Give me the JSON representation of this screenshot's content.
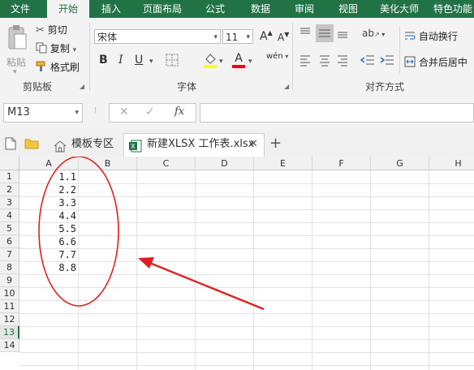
{
  "ribbon_tabs": [
    "文件",
    "开始",
    "插入",
    "页面布局",
    "公式",
    "数据",
    "审阅",
    "视图",
    "美化大师",
    "特色功能"
  ],
  "clipboard": {
    "paste": "粘贴",
    "cut": "剪切",
    "copy": "复制",
    "painter": "格式刷",
    "group": "剪贴板"
  },
  "font": {
    "name": "宋体",
    "size": "11",
    "group": "字体",
    "bold": "B",
    "italic": "I",
    "underline": "U",
    "grow": "A",
    "shrink": "A",
    "fill_color": "#ffff00",
    "font_color": "#ff0000",
    "phonetic": "wén"
  },
  "alignment": {
    "wrap": "自动换行",
    "merge": "合并后居中",
    "group": "对齐方式"
  },
  "formula_bar": {
    "name_box": "M13",
    "fx": "fx",
    "value": ""
  },
  "doc_tabs": {
    "template": "模板专区",
    "file": "新建XLSX 工作表.xlsx",
    "add": "+"
  },
  "sheet": {
    "columns": [
      "A",
      "B",
      "C",
      "D",
      "E",
      "F",
      "G",
      "H"
    ],
    "rows": [
      "1",
      "2",
      "3",
      "4",
      "5",
      "6",
      "7",
      "8",
      "9",
      "10",
      "11",
      "12",
      "13",
      "14"
    ],
    "active_row": "13",
    "colA_values": [
      "1.1",
      "2.2",
      "3.3",
      "4.4",
      "5.5",
      "6.6",
      "7.7",
      "8.8"
    ]
  },
  "annotation_color": "#e02020",
  "theme_color": "#217346"
}
